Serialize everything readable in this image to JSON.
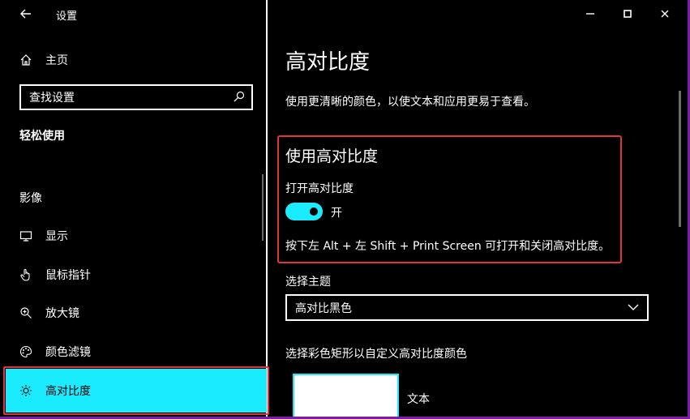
{
  "window": {
    "title": "设置",
    "controls": {
      "minimize": "—",
      "maximize": "☐",
      "close": "✕"
    }
  },
  "sidebar": {
    "home_label": "主页",
    "search_placeholder": "查找设置",
    "section_title": "轻松使用",
    "group_title": "影像",
    "items": [
      {
        "label": "显示",
        "icon": "monitor-icon"
      },
      {
        "label": "鼠标指针",
        "icon": "pointer-hand-icon"
      },
      {
        "label": "放大镜",
        "icon": "magnifier-icon"
      },
      {
        "label": "颜色滤镜",
        "icon": "palette-icon"
      },
      {
        "label": "高对比度",
        "icon": "brightness-icon",
        "selected": true
      }
    ]
  },
  "main": {
    "title": "高对比度",
    "description": "使用更清晰的颜色，以使文本和应用更易于查看。",
    "high_contrast": {
      "heading": "使用高对比度",
      "toggle_label": "打开高对比度",
      "toggle_state": "开",
      "toggle_on": true,
      "hint": "按下左 Alt + 左 Shift + Print Screen 可打开和关闭高对比度。"
    },
    "theme": {
      "label": "选择主题",
      "selected": "高对比黑色"
    },
    "colors": {
      "label": "选择彩色矩形以自定义高对比度颜色",
      "text_label": "文本"
    }
  },
  "colors": {
    "accent": "#1aebff",
    "highlight_border": "#e2343b",
    "background": "#000000",
    "foreground": "#ffffff"
  }
}
